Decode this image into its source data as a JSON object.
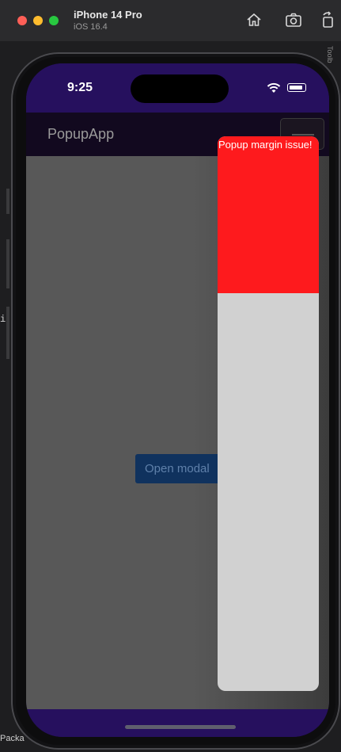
{
  "simulator": {
    "device_name": "iPhone 14 Pro",
    "os_version": "iOS 16.4",
    "toolbar_icons": [
      "home-icon",
      "screenshot-icon",
      "rotate-icon"
    ]
  },
  "background": {
    "side_text": "i",
    "right_text": "Toolb",
    "bottom_text": "Packa"
  },
  "status_bar": {
    "time": "9:25",
    "icons": [
      "wifi-icon",
      "battery-icon"
    ]
  },
  "app": {
    "title": "PopupApp",
    "menu_icon": "hamburger-menu-icon",
    "open_modal_label": "Open modal"
  },
  "popup": {
    "message": "Popup margin issue!",
    "top_color": "#fe1a1d",
    "body_color": "#d1d1d1"
  },
  "colors": {
    "status_bar": "#26105e",
    "toolbar": "#12091f",
    "content_overlay": "#585858"
  }
}
